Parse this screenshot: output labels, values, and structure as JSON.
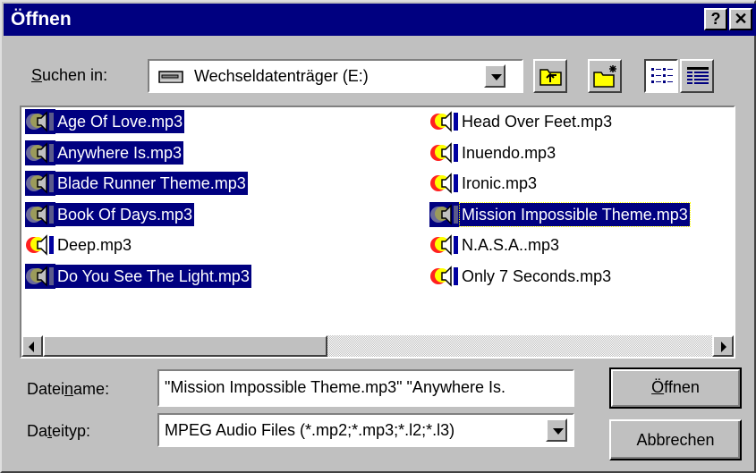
{
  "window": {
    "title": "Öffnen",
    "help_label": "?",
    "close_label": "✕"
  },
  "lookin": {
    "label_accel": "S",
    "label_rest": "uchen in:",
    "value": "Wechseldatenträger (E:)"
  },
  "files": [
    {
      "name": "Age Of Love.mp3",
      "selected": true,
      "focused": false,
      "icon": "mp3-selected-icon"
    },
    {
      "name": "Anywhere Is.mp3",
      "selected": true,
      "focused": false,
      "icon": "mp3-selected-icon"
    },
    {
      "name": "Blade Runner Theme.mp3",
      "selected": true,
      "focused": false,
      "icon": "mp3-selected-icon"
    },
    {
      "name": "Book Of Days.mp3",
      "selected": true,
      "focused": false,
      "icon": "mp3-selected-icon"
    },
    {
      "name": "Deep.mp3",
      "selected": false,
      "focused": false,
      "icon": "mp3-icon"
    },
    {
      "name": "Do You See The Light.mp3",
      "selected": true,
      "focused": false,
      "icon": "mp3-selected-icon"
    },
    {
      "name": "Head Over Feet.mp3",
      "selected": false,
      "focused": false,
      "icon": "mp3-icon"
    },
    {
      "name": "Inuendo.mp3",
      "selected": false,
      "focused": false,
      "icon": "mp3-icon"
    },
    {
      "name": "Ironic.mp3",
      "selected": false,
      "focused": false,
      "icon": "mp3-icon"
    },
    {
      "name": "Mission Impossible Theme.mp3",
      "selected": true,
      "focused": true,
      "icon": "mp3-selected-icon"
    },
    {
      "name": "N.A.S.A..mp3",
      "selected": false,
      "focused": false,
      "icon": "mp3-icon"
    },
    {
      "name": "Only 7 Seconds.mp3",
      "selected": false,
      "focused": false,
      "icon": "mp3-icon"
    }
  ],
  "filename": {
    "label_pre": "Datei",
    "label_accel": "n",
    "label_rest": "ame:",
    "value": "\"Mission Impossible Theme.mp3\" \"Anywhere Is."
  },
  "filetype": {
    "label_pre": "Da",
    "label_accel": "t",
    "label_rest": "eityp:",
    "value": "MPEG Audio Files (*.mp2;*.mp3;*.l2;*.l3)"
  },
  "buttons": {
    "open_accel": "Ö",
    "open_rest": "ffnen",
    "cancel": "Abbrechen"
  },
  "colors": {
    "title_bg": "#000080",
    "selection": "#000080",
    "face": "#c0c0c0"
  }
}
